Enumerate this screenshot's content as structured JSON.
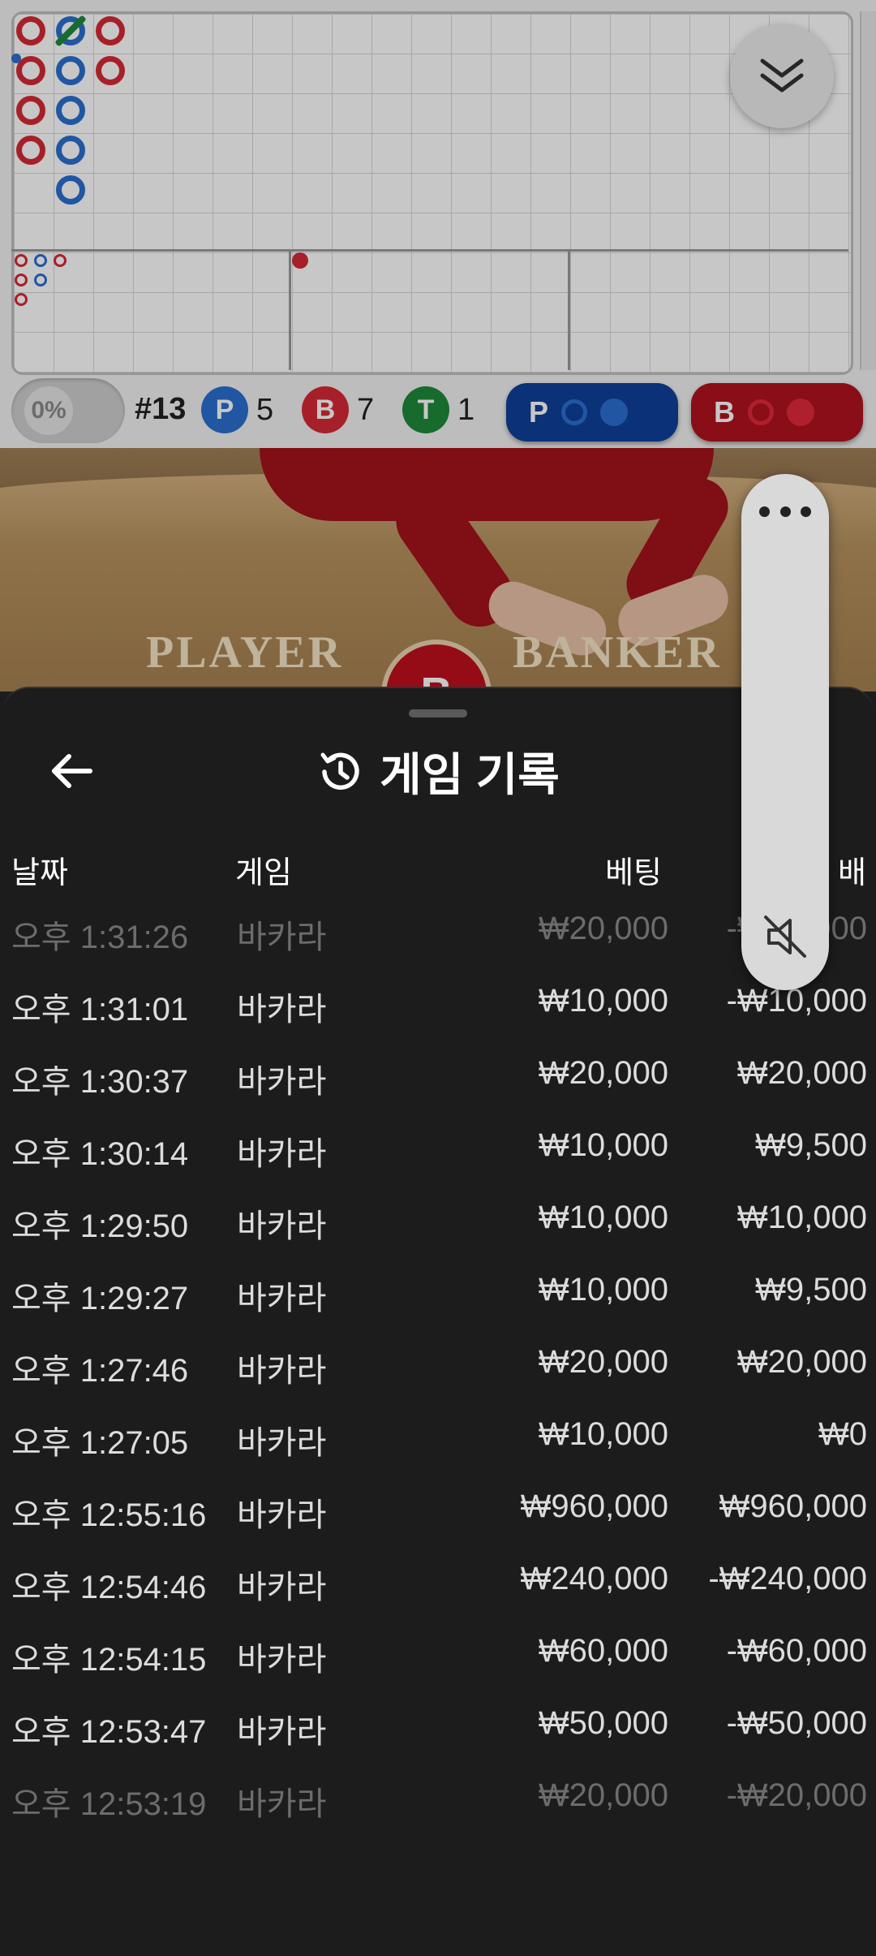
{
  "roadmap": {
    "round": "#13",
    "percent": "0%",
    "stats": [
      {
        "letter": "P",
        "count": "5",
        "color": "#2b6fd0"
      },
      {
        "letter": "B",
        "count": "7",
        "color": "#d62a35"
      },
      {
        "letter": "T",
        "count": "1",
        "color": "#1e8a3a"
      }
    ],
    "predict_player": "P",
    "predict_banker": "B"
  },
  "table": {
    "player_text": "PLAYER",
    "banker_text": "BANKER",
    "chip_letter": "B"
  },
  "panel": {
    "title": "게임 기록",
    "columns": {
      "date": "날짜",
      "game": "게임",
      "bet": "베팅",
      "payout": "배"
    },
    "rows": [
      {
        "date": "오후 1:31:26",
        "game": "바카라",
        "bet": "₩20,000",
        "payout": "-₩20,000"
      },
      {
        "date": "오후 1:31:01",
        "game": "바카라",
        "bet": "₩10,000",
        "payout": "-₩10,000"
      },
      {
        "date": "오후 1:30:37",
        "game": "바카라",
        "bet": "₩20,000",
        "payout": "₩20,000"
      },
      {
        "date": "오후 1:30:14",
        "game": "바카라",
        "bet": "₩10,000",
        "payout": "₩9,500"
      },
      {
        "date": "오후 1:29:50",
        "game": "바카라",
        "bet": "₩10,000",
        "payout": "₩10,000"
      },
      {
        "date": "오후 1:29:27",
        "game": "바카라",
        "bet": "₩10,000",
        "payout": "₩9,500"
      },
      {
        "date": "오후 1:27:46",
        "game": "바카라",
        "bet": "₩20,000",
        "payout": "₩20,000"
      },
      {
        "date": "오후 1:27:05",
        "game": "바카라",
        "bet": "₩10,000",
        "payout": "₩0"
      },
      {
        "date": "오후 12:55:16",
        "game": "바카라",
        "bet": "₩960,000",
        "payout": "₩960,000"
      },
      {
        "date": "오후 12:54:46",
        "game": "바카라",
        "bet": "₩240,000",
        "payout": "-₩240,000"
      },
      {
        "date": "오후 12:54:15",
        "game": "바카라",
        "bet": "₩60,000",
        "payout": "-₩60,000"
      },
      {
        "date": "오후 12:53:47",
        "game": "바카라",
        "bet": "₩50,000",
        "payout": "-₩50,000"
      },
      {
        "date": "오후 12:53:19",
        "game": "바카라",
        "bet": "₩20,000",
        "payout": "-₩20,000"
      }
    ]
  },
  "icons": {
    "collapse": "chevron-double-down-icon",
    "more": "more-dots-icon",
    "mute": "speaker-muted-icon",
    "back": "arrow-left-icon",
    "history": "history-icon"
  }
}
